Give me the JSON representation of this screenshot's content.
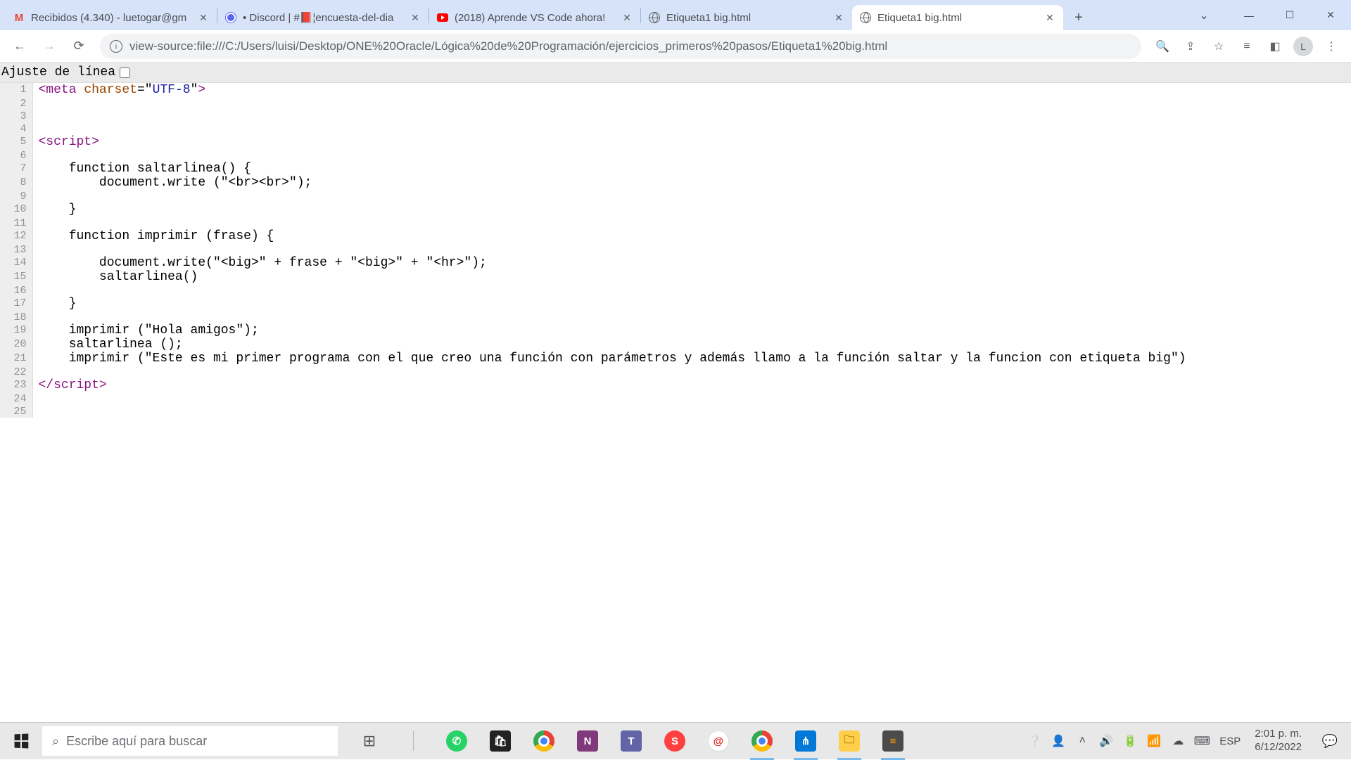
{
  "tabs": [
    {
      "title": "Recibidos (4.340) - luetogar@gm",
      "active": false
    },
    {
      "title": "• Discord | #📕¦encuesta-del-dia",
      "active": false
    },
    {
      "title": "(2018) Aprende VS Code ahora!",
      "active": false
    },
    {
      "title": "Etiqueta1 big.html",
      "active": false
    },
    {
      "title": "Etiqueta1 big.html",
      "active": true
    }
  ],
  "url": "view-source:file:///C:/Users/luisi/Desktop/ONE%20Oracle/Lógica%20de%20Programación/ejercicios_primeros%20pasos/Etiqueta1%20big.html",
  "line_wrap_label": "Ajuste de línea",
  "avatar_initial": "L",
  "source_lines": [
    {
      "n": 1,
      "html": "<span class='tag'>&lt;meta</span> <span class='attr-name'>charset</span>=\"<span class='attr-val'>UTF-8</span>\"<span class='tag'>&gt;</span>"
    },
    {
      "n": 2,
      "html": ""
    },
    {
      "n": 3,
      "html": ""
    },
    {
      "n": 4,
      "html": ""
    },
    {
      "n": 5,
      "html": "<span class='tag'>&lt;script&gt;</span>"
    },
    {
      "n": 6,
      "html": ""
    },
    {
      "n": 7,
      "html": "    function saltarlinea() {"
    },
    {
      "n": 8,
      "html": "        document.write (\"&lt;br&gt;&lt;br&gt;\");"
    },
    {
      "n": 9,
      "html": ""
    },
    {
      "n": 10,
      "html": "    }"
    },
    {
      "n": 11,
      "html": ""
    },
    {
      "n": 12,
      "html": "    function imprimir (frase) {"
    },
    {
      "n": 13,
      "html": ""
    },
    {
      "n": 14,
      "html": "        document.write(\"&lt;big&gt;\" + frase + \"&lt;big&gt;\" + \"&lt;hr&gt;\");"
    },
    {
      "n": 15,
      "html": "        saltarlinea()"
    },
    {
      "n": 16,
      "html": ""
    },
    {
      "n": 17,
      "html": "    }"
    },
    {
      "n": 18,
      "html": ""
    },
    {
      "n": 19,
      "html": "    imprimir (\"Hola amigos\");"
    },
    {
      "n": 20,
      "html": "    saltarlinea ();"
    },
    {
      "n": 21,
      "html": "    imprimir (\"Este es mi primer programa con el que creo una función con parámetros y además llamo a la función saltar y la funcion con etiqueta big\")"
    },
    {
      "n": 22,
      "html": ""
    },
    {
      "n": 23,
      "html": "<span class='tag'>&lt;/script&gt;</span>"
    },
    {
      "n": 24,
      "html": ""
    },
    {
      "n": 25,
      "html": ""
    }
  ],
  "taskbar": {
    "search_placeholder": "Escribe aquí para buscar",
    "lang": "ESP",
    "time": "2:01 p. m.",
    "date": "6/12/2022"
  }
}
